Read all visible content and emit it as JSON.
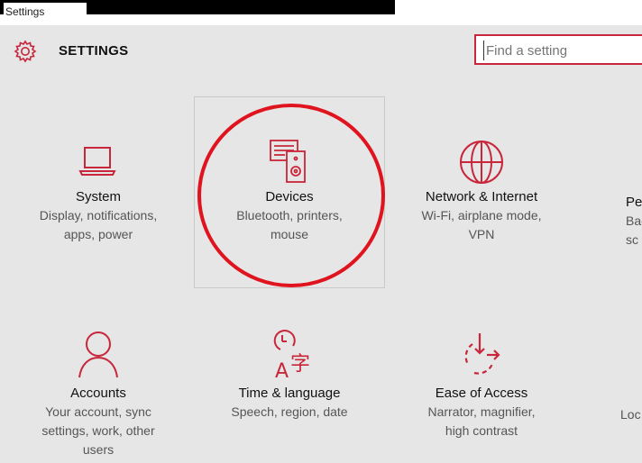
{
  "window": {
    "title": "Settings"
  },
  "header": {
    "title": "SETTINGS"
  },
  "search": {
    "placeholder": "Find a setting"
  },
  "tiles_row1": [
    {
      "title": "System",
      "desc": [
        "Display, notifications,",
        "apps, power"
      ]
    },
    {
      "title": "Devices",
      "desc": [
        "Bluetooth, printers,",
        "mouse"
      ]
    },
    {
      "title": "Network & Internet",
      "desc": [
        "Wi-Fi, airplane mode,",
        "VPN"
      ]
    },
    {
      "title": "Pe",
      "desc": [
        "Bac",
        "sc"
      ]
    }
  ],
  "tiles_row2": [
    {
      "title": "Accounts",
      "desc": [
        "Your account, sync",
        "settings, work, other",
        "users"
      ]
    },
    {
      "title": "Time & language",
      "desc": [
        "Speech, region, date"
      ]
    },
    {
      "title": "Ease of Access",
      "desc": [
        "Narrator, magnifier,",
        "high contrast"
      ]
    },
    {
      "title": "",
      "desc": [
        "Loc"
      ]
    }
  ],
  "colors": {
    "accent": "#c8263a",
    "annotation": "#e0141e",
    "background": "#e6e6e6"
  }
}
